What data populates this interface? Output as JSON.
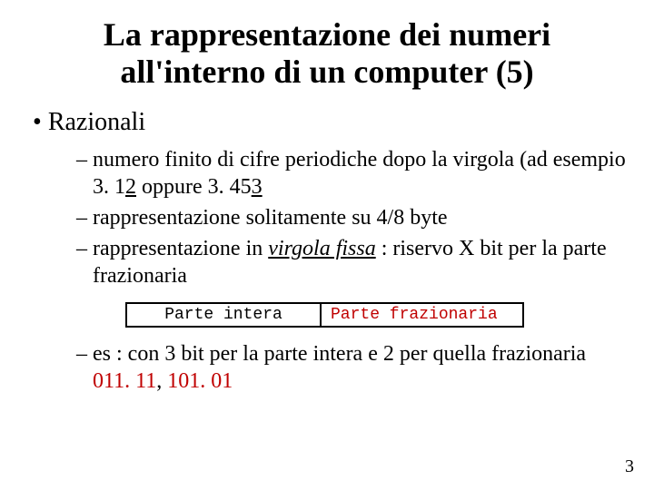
{
  "title": "La rappresentazione dei numeri all'interno di un computer (5)",
  "bullet1": "Razionali",
  "sub1_a": "numero finito di cifre periodiche dopo la virgola (ad esempio 3. 1",
  "sub1_b": "2",
  "sub1_c": "  oppure  3. 45",
  "sub1_d": "3",
  "sub2": "rappresentazione solitamente su 4/8 byte",
  "sub3_a": "rappresentazione in ",
  "sub3_b": "virgola fissa",
  "sub3_c": " : riservo X bit per la parte frazionaria",
  "box_int": "Parte intera",
  "box_frac": "Parte frazionaria",
  "sub4_a": "es : con 3 bit per la parte intera e 2 per quella frazionaria ",
  "sub4_b": "011. 11",
  "sub4_c": ", ",
  "sub4_d": "101. 01",
  "page": "3"
}
